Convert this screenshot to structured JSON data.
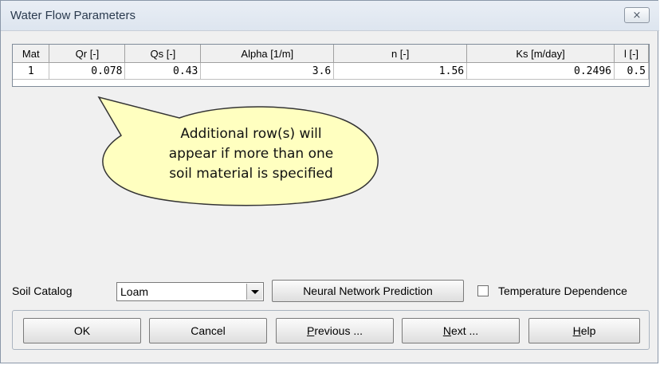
{
  "window": {
    "title": "Water Flow Parameters",
    "close_glyph": "⨯"
  },
  "grid": {
    "headers": [
      "Mat",
      "Qr [-]",
      "Qs [-]",
      "Alpha [1/m]",
      "n [-]",
      "Ks [m/day]",
      "l [-]"
    ],
    "rows": [
      [
        "1",
        "0.078",
        "0.43",
        "3.6",
        "1.56",
        "0.2496",
        "0.5"
      ]
    ]
  },
  "callout": {
    "lines": [
      "Additional row(s) will",
      "appear if more than one",
      "soil material is specified"
    ],
    "fill": "#ffffc0",
    "stroke": "#333333"
  },
  "soil_catalog": {
    "label": "Soil Catalog",
    "selected": "Loam"
  },
  "neural_button": {
    "label": "Neural Network Prediction"
  },
  "temperature": {
    "label": "Temperature Dependence",
    "checked": false
  },
  "buttons": {
    "ok": "OK",
    "cancel": "Cancel",
    "previous_mnemonic": "P",
    "previous_rest": "revious ...",
    "next_mnemonic": "N",
    "next_rest": "ext ...",
    "help_mnemonic": "H",
    "help_rest": "elp"
  }
}
